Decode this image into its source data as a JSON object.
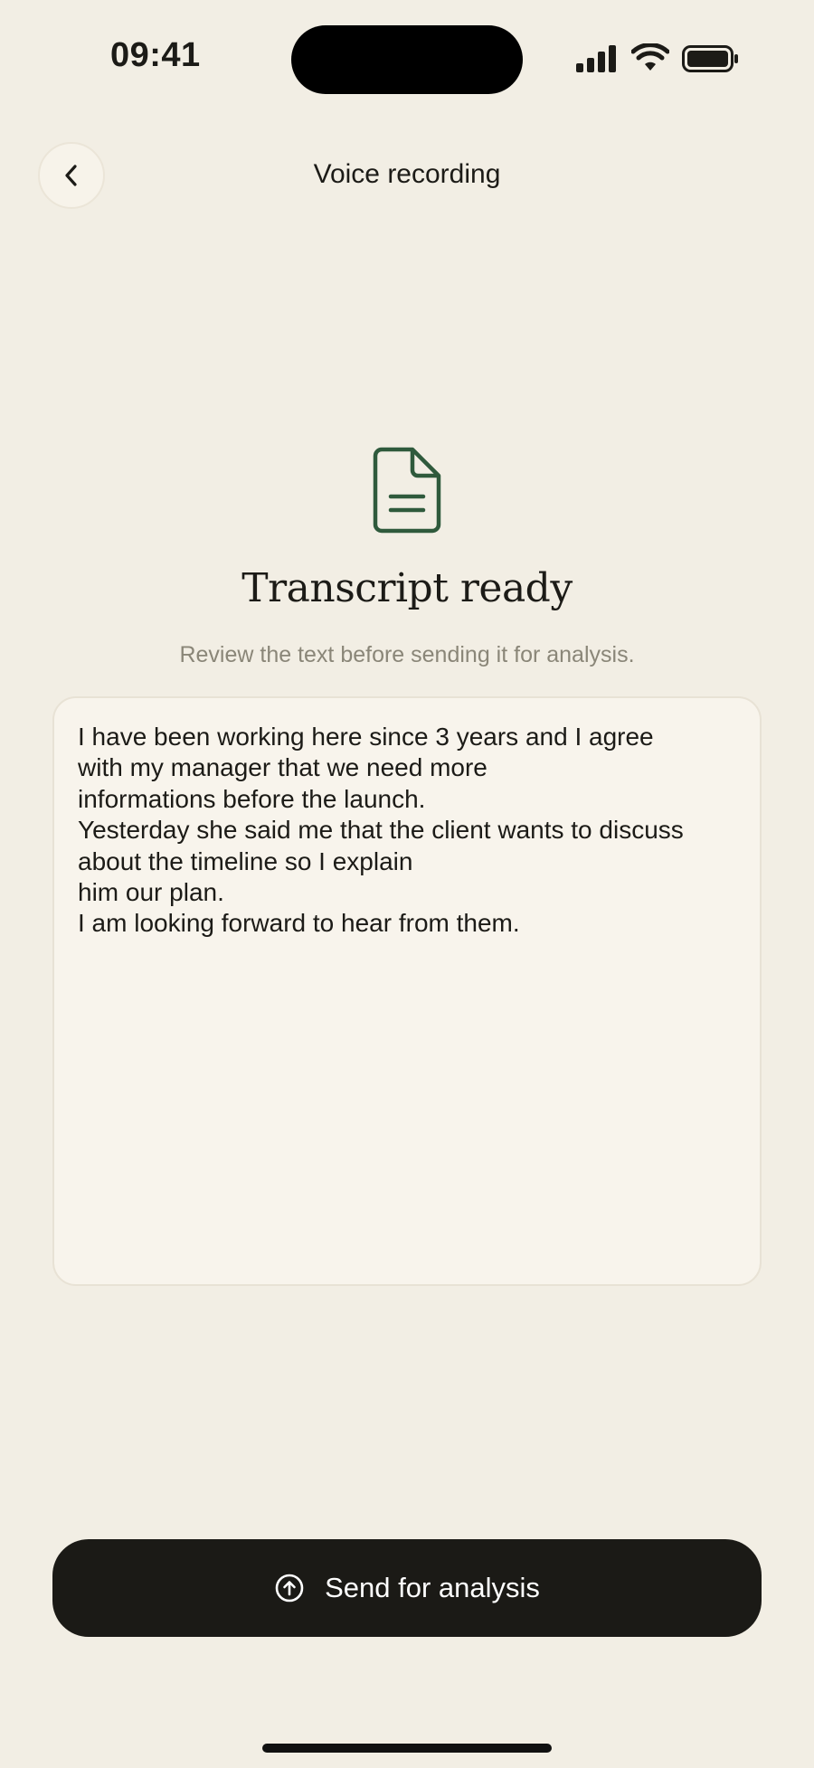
{
  "status_bar": {
    "time": "09:41",
    "icons": [
      "cellular-signal-icon",
      "wifi-icon",
      "battery-icon"
    ]
  },
  "header": {
    "back_icon": "chevron-left-icon",
    "title": "Voice recording"
  },
  "main": {
    "icon": "document-icon",
    "title": "Transcript ready",
    "subtitle": "Review the text before sending it for analysis.",
    "transcript_lines": [
      "I have been working here since 3 years and I agree",
      "with my manager that we need more",
      "informations before the launch.",
      "Yesterday she said me that the client wants to discuss",
      "about the timeline so I explain",
      "him our plan.",
      "I am looking forward to hear from them."
    ]
  },
  "footer": {
    "send_icon": "upload-circle-icon",
    "send_label": "Send for analysis"
  },
  "colors": {
    "background": "#f2eee4",
    "accent_green": "#2f5a3c",
    "button_dark": "#1b1a16",
    "muted_text": "#8a8678"
  }
}
